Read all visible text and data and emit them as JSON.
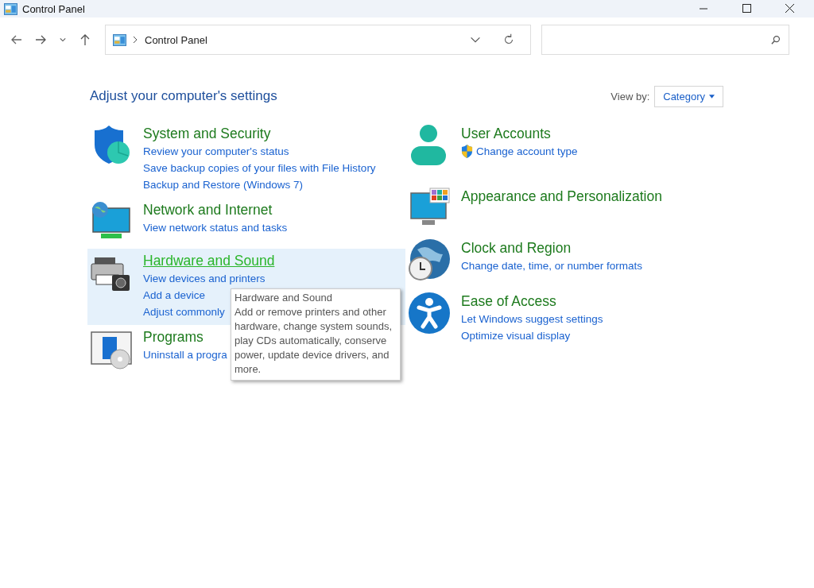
{
  "window": {
    "title": "Control Panel"
  },
  "address_bar": {
    "path": "Control Panel"
  },
  "heading": "Adjust your computer's settings",
  "view_by": {
    "label": "View by:",
    "value": "Category"
  },
  "columns": [
    {
      "categories": [
        {
          "title": "System and Security",
          "highlighted": false,
          "links": [
            {
              "text": "Review your computer's status",
              "shield": false
            },
            {
              "text": "Save backup copies of your files with File History",
              "shield": false
            },
            {
              "text": "Backup and Restore (Windows 7)",
              "shield": false
            }
          ]
        },
        {
          "title": "Network and Internet",
          "highlighted": false,
          "links": [
            {
              "text": "View network status and tasks",
              "shield": false
            }
          ]
        },
        {
          "title": "Hardware and Sound",
          "highlighted": true,
          "links": [
            {
              "text": "View devices and printers",
              "shield": false
            },
            {
              "text": "Add a device",
              "shield": false
            },
            {
              "text": "Adjust commonly",
              "shield": false
            }
          ]
        },
        {
          "title": "Programs",
          "highlighted": false,
          "links": [
            {
              "text": "Uninstall a progra",
              "shield": false
            }
          ]
        }
      ]
    },
    {
      "categories": [
        {
          "title": "User Accounts",
          "highlighted": false,
          "links": [
            {
              "text": "Change account type",
              "shield": true
            }
          ]
        },
        {
          "title": "Appearance and Personalization",
          "highlighted": false
        },
        {
          "title": "Clock and Region",
          "highlighted": false,
          "links": [
            {
              "text": "Change date, time, or number formats",
              "shield": false
            }
          ]
        },
        {
          "title": "Ease of Access",
          "highlighted": false,
          "links": [
            {
              "text": "Let Windows suggest settings",
              "shield": false
            },
            {
              "text": "Optimize visual display",
              "shield": false
            }
          ]
        }
      ]
    }
  ],
  "tooltip": {
    "title": "Hardware and Sound",
    "text": "Add or remove printers and other hardware, change system sounds, play CDs automatically, conserve power, update device drivers, and more."
  }
}
